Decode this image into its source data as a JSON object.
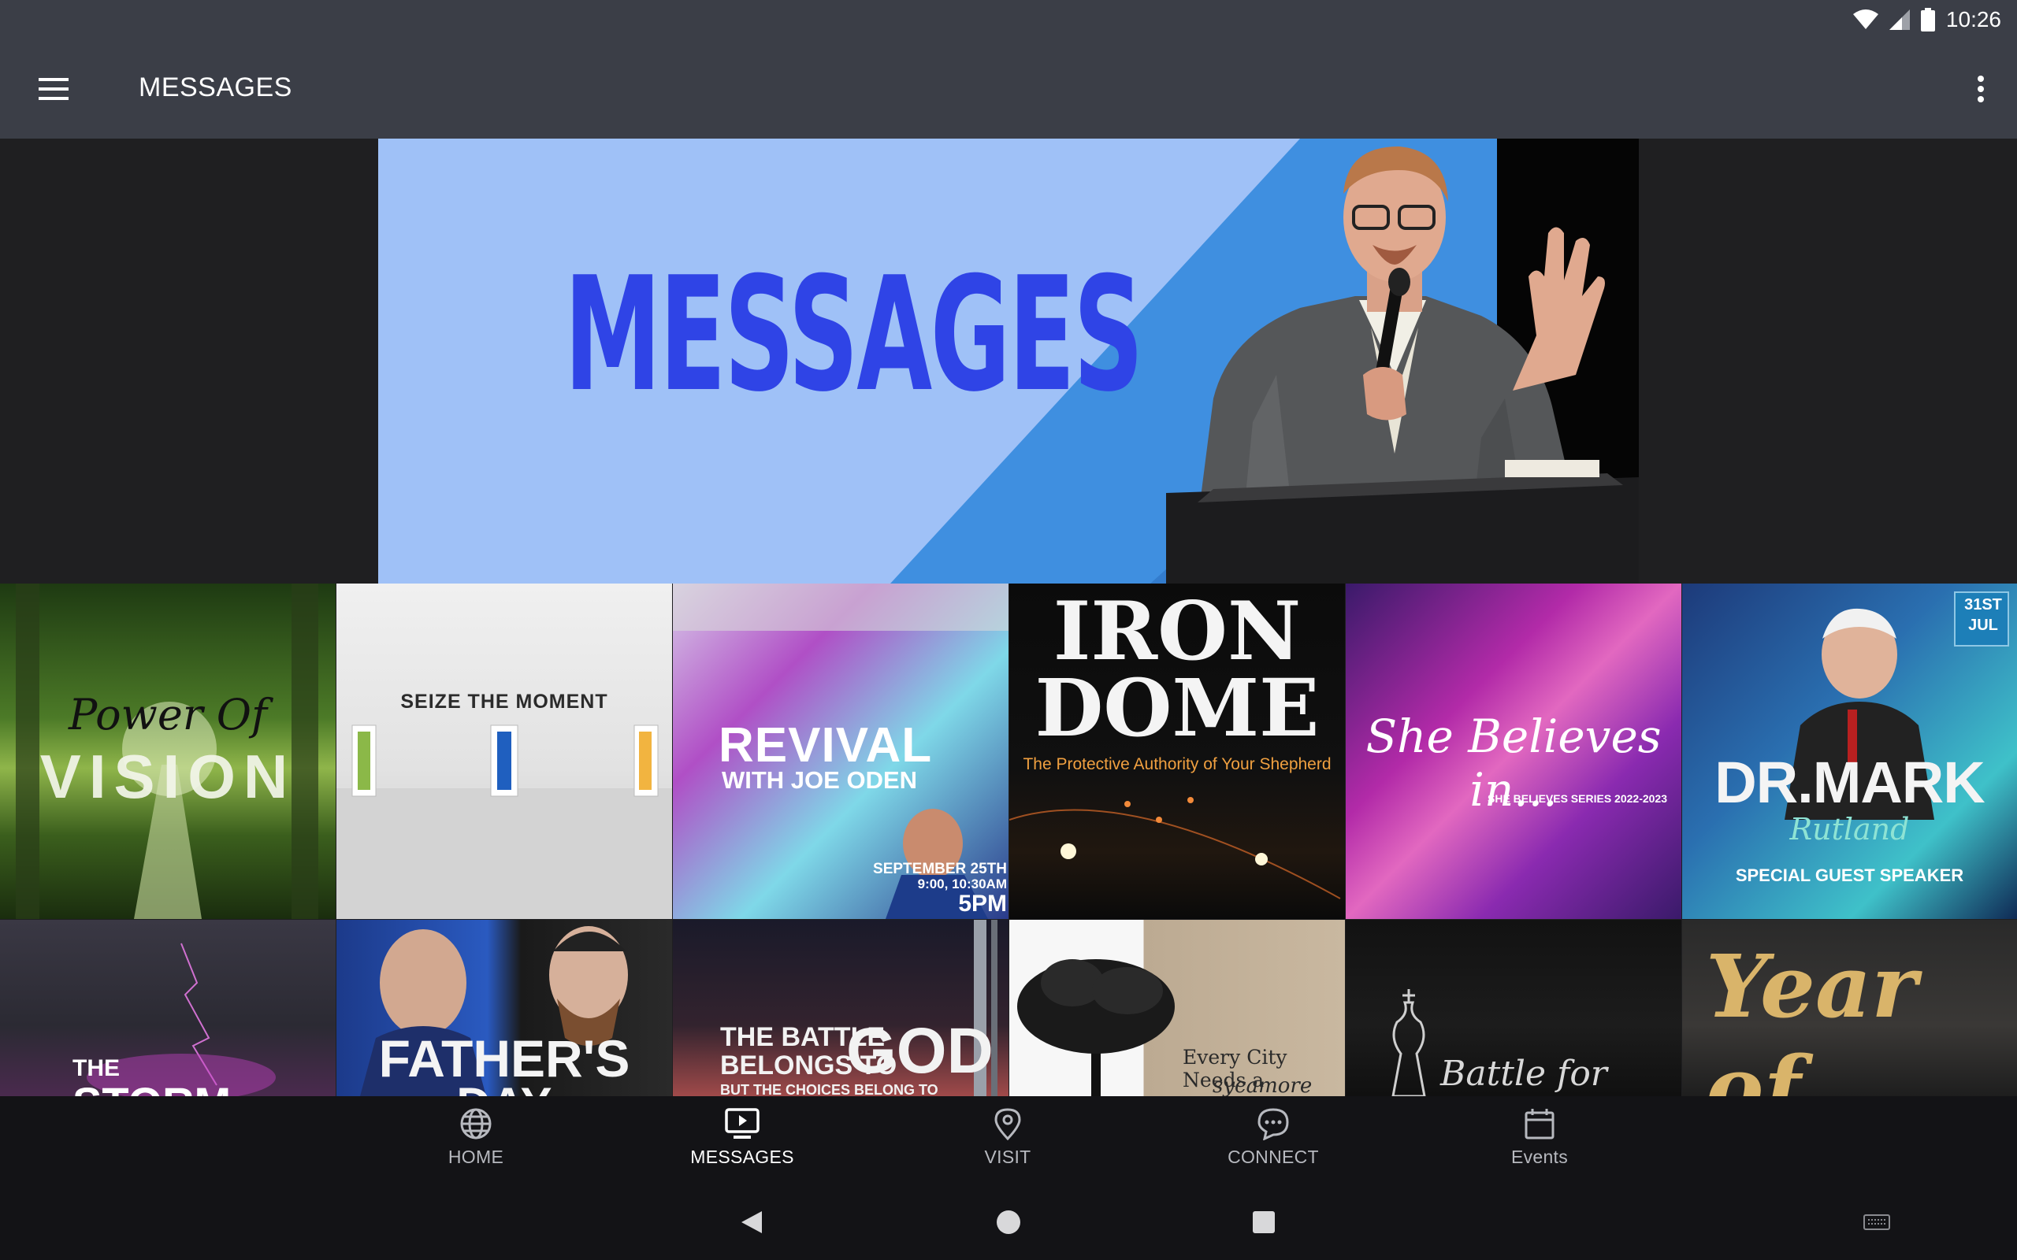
{
  "status": {
    "time": "10:26"
  },
  "appbar": {
    "title": "MESSAGES"
  },
  "hero": {
    "title": "MESSAGES"
  },
  "tiles": {
    "power_of_vision": {
      "line1": "Power Of",
      "line2": "VISION"
    },
    "seize_the_moment": {
      "title": "SEIZE   THE   MOMENT"
    },
    "revival": {
      "title": "REVIVAL",
      "subtitle": "WITH JOE ODEN",
      "date": "SEPTEMBER 25TH",
      "times": "9:00, 10:30AM",
      "time2": "5PM"
    },
    "iron_dome": {
      "line1": "IRON",
      "line2": "DOME",
      "subtitle": "The Protective Authority of Your Shepherd"
    },
    "she_believes": {
      "title": "She Believes in...",
      "subtitle": "SHE BELIEVES SERIES 2022-2023"
    },
    "dr_mark": {
      "date_day": "31ST",
      "date_month": "JUL",
      "name": "DR.MARK",
      "surname": "Rutland",
      "caption": "SPECIAL GUEST SPEAKER"
    },
    "the_storm": {
      "line1": "THE",
      "line2": "STORM"
    },
    "fathers_day": {
      "title": "FATHER'S",
      "title2": "DAY"
    },
    "battle_belongs": {
      "line1": "THE BATTLE",
      "line2": "BELONGS TO",
      "word": "GOD",
      "line3": "BUT THE CHOICES BELONG TO"
    },
    "every_city": {
      "line1": "Every City Needs a",
      "line2": "sycamore tree"
    },
    "battle_for": {
      "title": "Battle for"
    },
    "year_of": {
      "title": "Year of"
    }
  },
  "bottom_nav": [
    {
      "label": "HOME",
      "icon": "globe-icon"
    },
    {
      "label": "MESSAGES",
      "icon": "tv-play-icon"
    },
    {
      "label": "VISIT",
      "icon": "location-pin-icon"
    },
    {
      "label": "CONNECT",
      "icon": "chat-bubble-icon"
    },
    {
      "label": "Events",
      "icon": "calendar-icon"
    }
  ],
  "colors": {
    "bar": "#3b3e47",
    "hero_light": "#9fc1f7",
    "hero_blue": "#2f44e6",
    "nav_bg": "#131316"
  }
}
